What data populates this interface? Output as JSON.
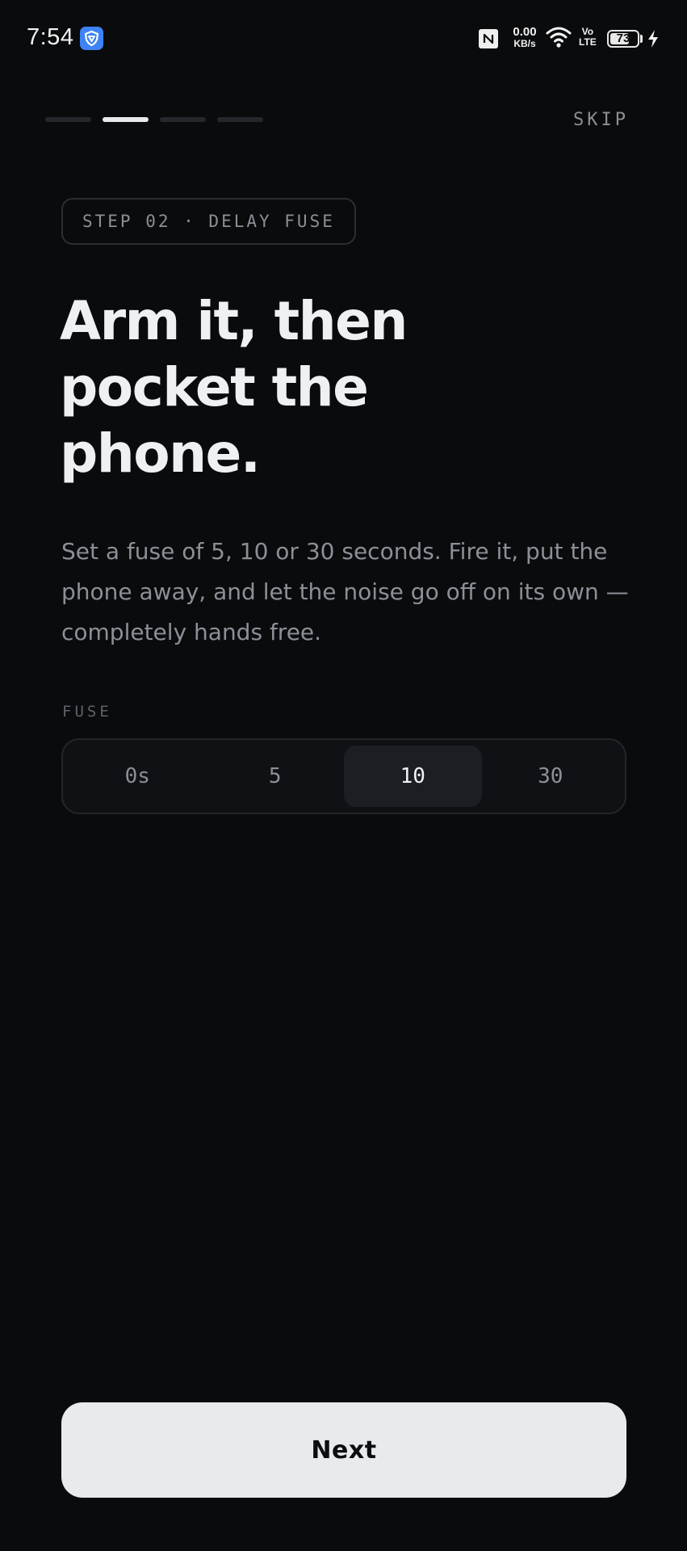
{
  "status_bar": {
    "time": "7:54",
    "app_icon": "shield-app-icon",
    "nfc_icon": "nfc-icon",
    "net_speed_value": "0.00",
    "net_speed_unit": "KB/s",
    "wifi_icon": "wifi-icon",
    "volte_top": "Vo",
    "volte_bottom": "LTE",
    "battery_level": "73",
    "battery_fraction": 0.73,
    "charging_icon": "bolt-icon"
  },
  "onboarding": {
    "progress": {
      "total_steps": 4,
      "current_step": 2
    },
    "skip_label": "SKIP",
    "step_badge": "STEP 02 · DELAY FUSE",
    "headline_lines": [
      "Arm it, then",
      "pocket the",
      "phone."
    ],
    "body": "Set a fuse of 5, 10 or 30 seconds. Fire it, put the phone away, and let the noise go off on its own — completely hands free.",
    "fuse": {
      "label": "FUSE",
      "options": [
        "0s",
        "5",
        "10",
        "30"
      ],
      "selected": "10"
    },
    "next_label": "Next"
  },
  "colors": {
    "background": "#0a0b0d",
    "accent_light": "#e9eaee",
    "muted_text": "#8c8f96"
  }
}
